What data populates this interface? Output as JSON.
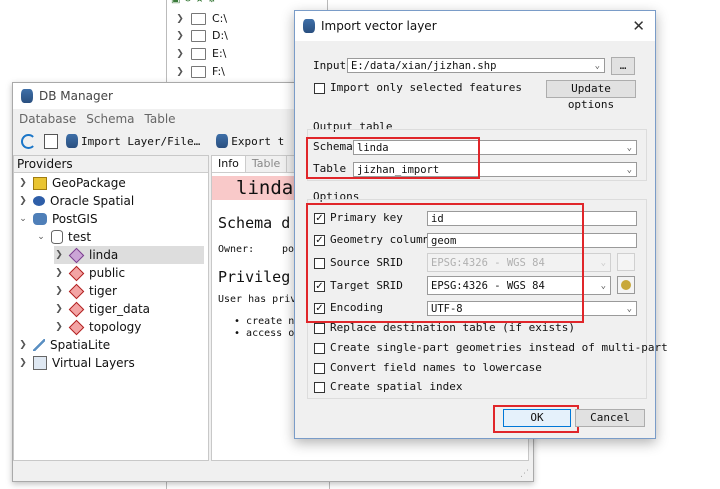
{
  "browser": {
    "items": [
      "C:\\",
      "D:\\",
      "E:\\",
      "F:\\"
    ]
  },
  "dbmanager": {
    "title": "DB Manager",
    "menu": [
      "Database",
      "Schema",
      "Table"
    ],
    "toolbar": {
      "import_label": "Import Layer/File…",
      "export_label": "Export t"
    },
    "providers_header": "Providers",
    "tree": {
      "geopackage": "GeoPackage",
      "oracle": "Oracle Spatial",
      "postgis": "PostGIS",
      "test": "test",
      "linda": "linda",
      "public": "public",
      "tiger": "tiger",
      "tiger_data": "tiger_data",
      "topology": "topology",
      "spatialite": "SpatiaLite",
      "virtual": "Virtual Layers"
    },
    "info": {
      "tab_info": "Info",
      "tab_table": "Table",
      "schema_name": "linda",
      "schema_heading": "Schema d",
      "owner_label": "Owner:",
      "owner_value": "po",
      "privileges_heading": "Privileg",
      "user_has_priv": "User has priv",
      "bullet1": "create n",
      "bullet2": "access o"
    }
  },
  "dialog": {
    "title": "Import vector layer",
    "input_label": "Input",
    "input_value": "E:/data/xian/jizhan.shp",
    "browse_label": "…",
    "only_selected_label": "Import only selected features",
    "update_options_label": "Update options",
    "output_table_label": "Output table",
    "schema_label": "Schema",
    "schema_value": "linda",
    "table_label": "Table",
    "table_value": "jizhan_import",
    "options_label": "Options",
    "primary_key_label": "Primary key",
    "primary_key_value": "id",
    "geometry_column_label": "Geometry column",
    "geometry_column_value": "geom",
    "source_srid_label": "Source SRID",
    "source_srid_value": "EPSG:4326 - WGS 84",
    "target_srid_label": "Target SRID",
    "target_srid_value": "EPSG:4326 - WGS 84",
    "encoding_label": "Encoding",
    "encoding_value": "UTF-8",
    "replace_label": "Replace destination table (if exists)",
    "single_part_label": "Create single-part geometries instead of multi-part",
    "lowercase_label": "Convert field names to lowercase",
    "spatial_index_label": "Create spatial index",
    "ok_label": "OK",
    "cancel_label": "Cancel",
    "checks": {
      "only_selected": false,
      "primary_key": true,
      "geometry_column": true,
      "source_srid": false,
      "target_srid": true,
      "encoding": true,
      "replace": false,
      "single_part": false,
      "lowercase": false,
      "spatial_index": false
    }
  },
  "colors": {
    "highlight": "#e0262a",
    "accent": "#1b76c8"
  }
}
